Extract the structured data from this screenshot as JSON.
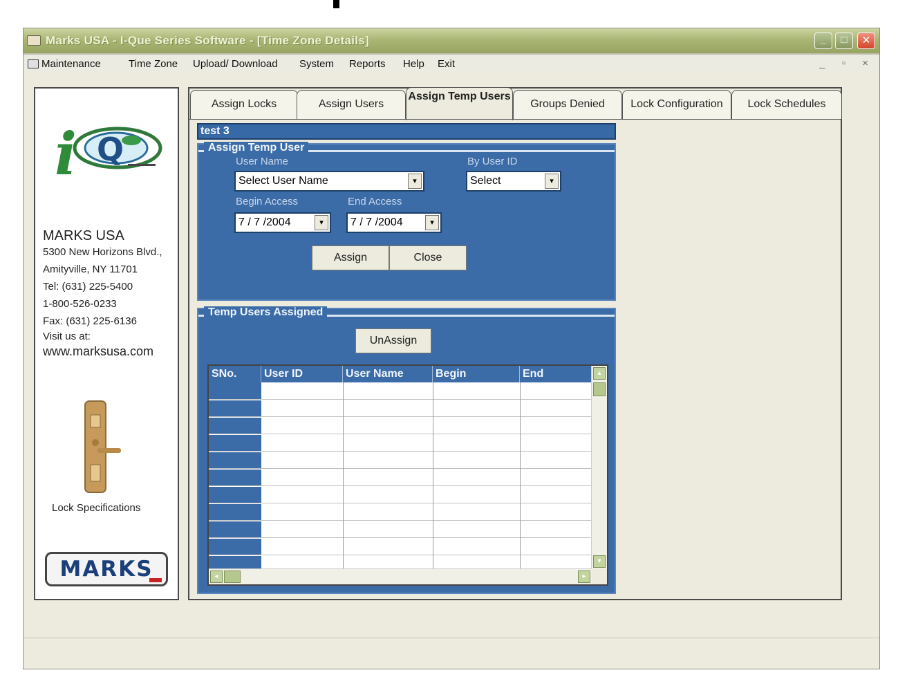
{
  "window": {
    "title": "Marks USA - I-Que Series Software - [Time Zone Details]",
    "minimize_glyph": "_",
    "maximize_glyph": "□",
    "close_glyph": "✕"
  },
  "menu": {
    "items": [
      "Maintenance",
      "Time Zone",
      "Upload/ Download",
      "System",
      "Reports",
      "Help",
      "Exit"
    ],
    "mdi_controls": "_ ▫ ×"
  },
  "sidebar": {
    "company": "MARKS USA",
    "address_lines": [
      "5300 New Horizons Blvd.,",
      "Amityville, NY 11701",
      "Tel: (631) 225-5400",
      "1-800-526-0233",
      "Fax: (631) 225-6136",
      "Visit us at:"
    ],
    "website": "www.marksusa.com",
    "lock_spec_label": "Lock Specifications",
    "marks_logo_text": "MARKS"
  },
  "tabs": [
    {
      "label": "Assign Locks"
    },
    {
      "label": "Assign Users"
    },
    {
      "label": "Assign Temp Users"
    },
    {
      "label": "Groups Denied"
    },
    {
      "label": "Lock Configuration"
    },
    {
      "label": "Lock Schedules"
    }
  ],
  "selected_item": "test 3",
  "assign_panel": {
    "legend": "Assign Temp User",
    "user_name_label": "User Name",
    "user_name_value": "Select User Name",
    "by_user_id_label": "By User ID",
    "by_user_id_value": "Select",
    "begin_access_label": "Begin Access",
    "begin_access_value": "7 / 7 /2004",
    "end_access_label": "End Access",
    "end_access_value": "7 / 7 /2004",
    "assign_button": "Assign",
    "close_button": "Close"
  },
  "assigned_panel": {
    "legend": "Temp Users Assigned",
    "unassign_button": "UnAssign",
    "columns": [
      "SNo.",
      "User ID",
      "User Name",
      "Begin",
      "End"
    ],
    "rows": []
  },
  "colors": {
    "panel_blue": "#3b6ca8",
    "title_bar_green": "#a9b674",
    "close_red": "#d1472c"
  },
  "icons": {
    "dropdown": "▾",
    "scroll_up": "▴",
    "scroll_down": "▾",
    "scroll_left": "◂",
    "scroll_right": "▸"
  }
}
